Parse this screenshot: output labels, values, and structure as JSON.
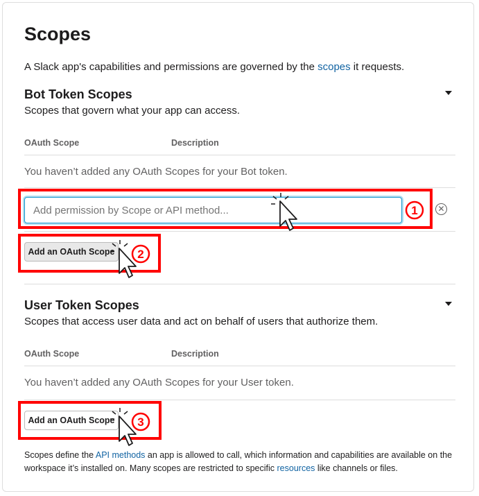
{
  "page": {
    "title": "Scopes",
    "intro_before": "A Slack app's capabilities and permissions are governed by the ",
    "intro_link": "scopes",
    "intro_after": " it requests."
  },
  "bot_section": {
    "title": "Bot Token Scopes",
    "subtitle": "Scopes that govern what your app can access.",
    "col_scope": "OAuth Scope",
    "col_desc": "Description",
    "empty_text": "You haven’t added any OAuth Scopes for your Bot token.",
    "input_placeholder": "Add permission by Scope or API method...",
    "add_button": "Add an OAuth Scope"
  },
  "user_section": {
    "title": "User Token Scopes",
    "subtitle": "Scopes that access user data and act on behalf of users that authorize them.",
    "col_scope": "OAuth Scope",
    "col_desc": "Description",
    "empty_text": "You haven’t added any OAuth Scopes for your User token.",
    "add_button": "Add an OAuth Scope"
  },
  "footer": {
    "text1": "Scopes define the ",
    "link1": "API methods",
    "text2": " an app is allowed to call, which information and capabilities are available on the workspace it’s installed on. Many scopes are restricted to specific ",
    "link2": "resources",
    "text3": " like channels or files."
  },
  "annotations": {
    "step1": "①",
    "step2": "②",
    "step3": "③",
    "highlight_color": "#ff0000"
  },
  "colors": {
    "link": "#1264a3",
    "focus": "#1d9bd1"
  }
}
